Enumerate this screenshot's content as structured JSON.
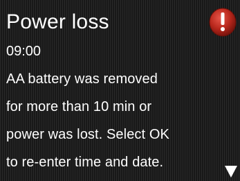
{
  "screen": {
    "title": "Power loss",
    "time": "09:00",
    "message_lines": [
      "AA battery was removed",
      "for more than 10 min or",
      "power was lost. Select OK",
      "to re-enter time and date."
    ]
  },
  "icons": {
    "alert": "alert-icon",
    "scroll": "scroll-down-icon"
  },
  "colors": {
    "text": "#ffffff",
    "alert_red": "#c0392b",
    "background": "#1f1f1f"
  }
}
